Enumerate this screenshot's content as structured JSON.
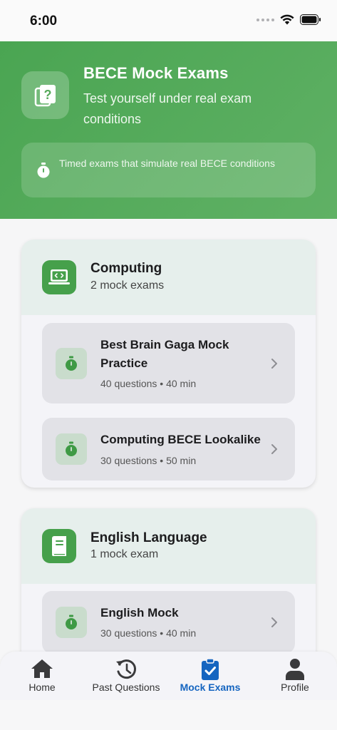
{
  "status": {
    "time": "6:00"
  },
  "hero": {
    "title": "BECE Mock Exams",
    "subtitle": "Test yourself under real exam conditions",
    "note": "Timed exams that simulate real BECE conditions"
  },
  "subjects": [
    {
      "name": "Computing",
      "count": "2 mock exams",
      "exams": [
        {
          "title": "Best Brain Gaga Mock Practice",
          "questions": "40 questions",
          "duration": "40 min"
        },
        {
          "title": "Computing BECE Lookalike",
          "questions": "30 questions",
          "duration": "50 min"
        }
      ]
    },
    {
      "name": "English Language",
      "count": "1 mock exam",
      "exams": [
        {
          "title": "English Mock",
          "questions": "30 questions",
          "duration": "40 min"
        }
      ]
    }
  ],
  "tabs": [
    {
      "label": "Home",
      "icon": "home-icon"
    },
    {
      "label": "Past Questions",
      "icon": "history-icon"
    },
    {
      "label": "Mock Exams",
      "icon": "clipboard-check-icon",
      "active": true
    },
    {
      "label": "Profile",
      "icon": "person-icon"
    }
  ],
  "colors": {
    "brand_green": "#4aa552",
    "active_tab": "#1565c0",
    "timer_green": "#3f9a45"
  }
}
